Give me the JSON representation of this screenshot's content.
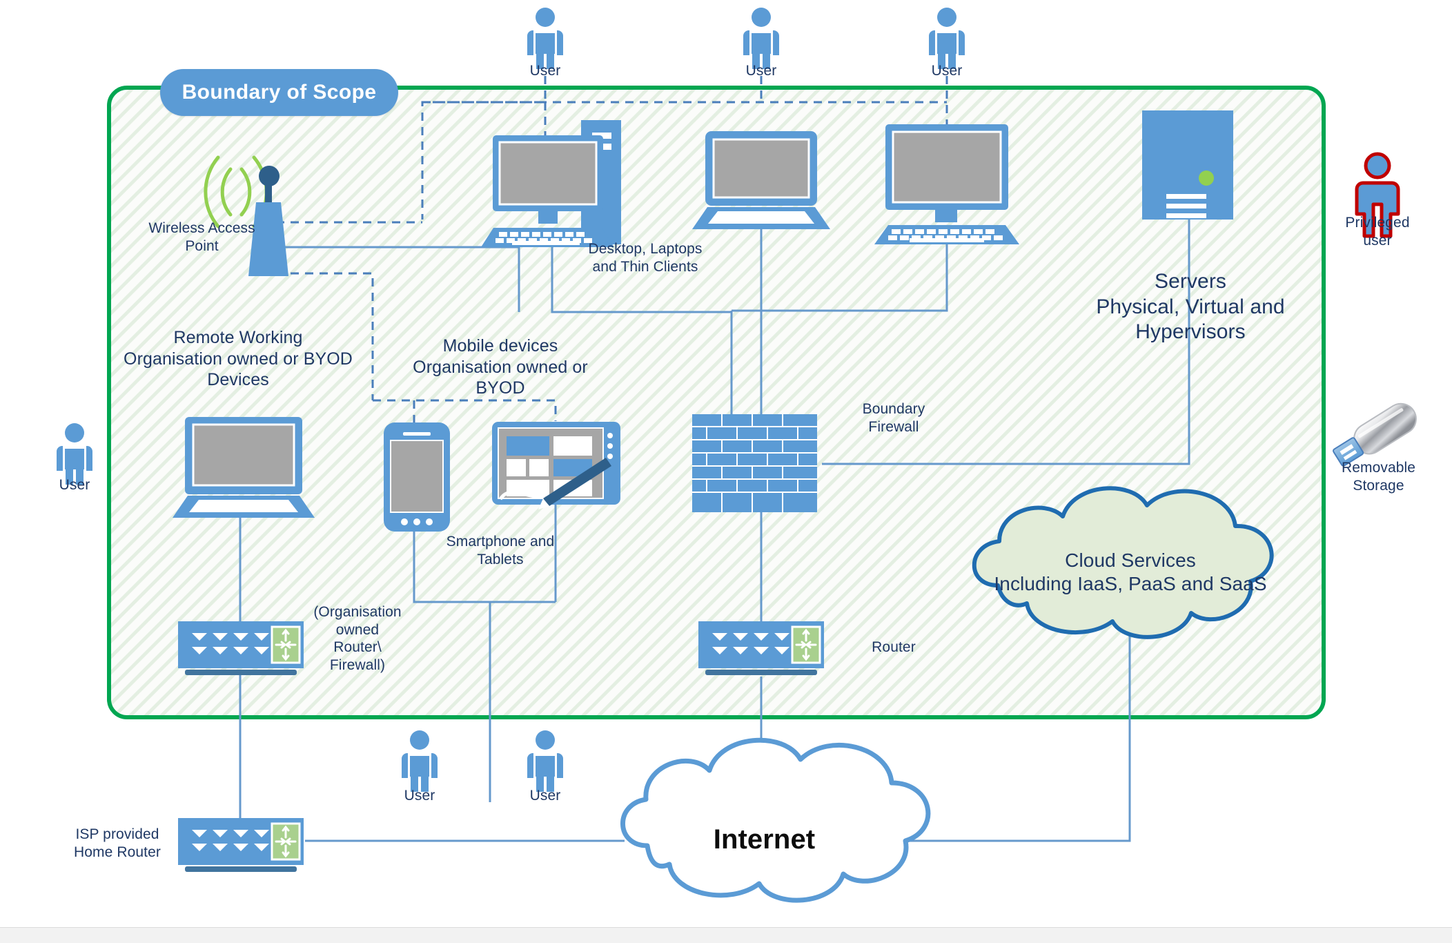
{
  "diagram": {
    "title": "Boundary of Scope",
    "accent_blue": "#5b9bd5",
    "boundary_green": "#00a651",
    "cloud_green_fill": "#e2ecd8",
    "screen_gray": "#a6a6a6",
    "privileged_red": "#c00000"
  },
  "boundary": {
    "label": "Boundary of Scope"
  },
  "labels": {
    "wireless_access_point": "Wireless Access\nPoint",
    "desktop_laptops_thin_clients": "Desktop, Laptops\nand Thin Clients",
    "servers": "Servers\nPhysical, Virtual and\nHypervisors",
    "privileged_user": "Privileged\nuser",
    "removable_storage": "Removable\nStorage",
    "remote_working": "Remote Working\nOrganisation owned or BYOD\nDevices",
    "mobile_devices": "Mobile devices\nOrganisation owned or BYOD",
    "smartphone_tablets": "Smartphone and\nTablets",
    "boundary_firewall": "Boundary\nFirewall",
    "organisation_router_firewall": "(Organisation\nowned\nRouter\\\nFirewall)",
    "router": "Router",
    "isp_home_router": "ISP provided\nHome Router",
    "cloud_services": "Cloud Services\nIncluding IaaS, PaaS and SaaS",
    "internet": "Internet"
  },
  "users": {
    "top_user_1": "User",
    "top_user_2": "User",
    "top_user_3": "User",
    "left_user": "User",
    "bottom_user_1": "User",
    "bottom_user_2": "User"
  },
  "icon_names": {
    "user": "user-icon",
    "privileged_user": "privileged-user-icon",
    "wireless_access_point": "wireless-access-point-icon",
    "desktop": "desktop-computer-icon",
    "laptop": "laptop-icon",
    "thin_client": "thin-client-icon",
    "server": "server-tower-icon",
    "usb": "usb-removable-storage-icon",
    "smartphone": "smartphone-icon",
    "tablet": "tablet-stylus-icon",
    "firewall": "brick-firewall-icon",
    "router": "router-icon",
    "cloud": "cloud-icon"
  }
}
